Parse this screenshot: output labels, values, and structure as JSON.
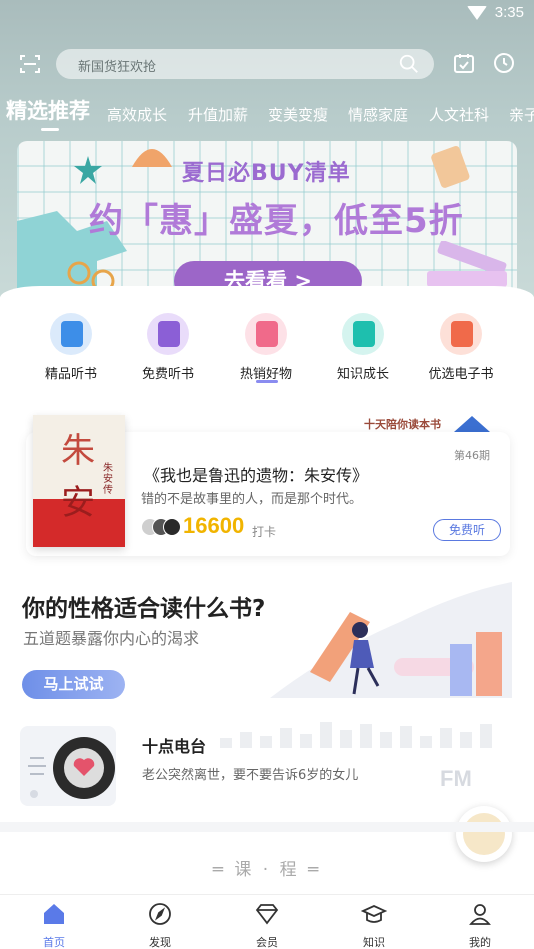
{
  "status": {
    "time": "3:35"
  },
  "search": {
    "placeholder": "新国货狂欢抢"
  },
  "tabs": [
    "精选推荐",
    "高效成长",
    "升值加薪",
    "变美变瘦",
    "情感家庭",
    "人文社科",
    "亲子"
  ],
  "banner": {
    "line1": "夏日必BUY清单",
    "line2": "约「惠」盛夏，低至5折",
    "button": "去看看 >"
  },
  "quick_entries": [
    {
      "label": "精品听书",
      "icon": "audiobook-icon",
      "color": "#3d8ee8"
    },
    {
      "label": "免费听书",
      "icon": "free-book-icon",
      "color": "#8b5fd6"
    },
    {
      "label": "热销好物",
      "icon": "sale-bag-icon",
      "color": "#f06a8a"
    },
    {
      "label": "知识成长",
      "icon": "knowledge-board-icon",
      "color": "#1ebfae"
    },
    {
      "label": "优选电子书",
      "icon": "ebook-icon",
      "color": "#f06a4a"
    }
  ],
  "book": {
    "strip": "十天陪你读本书",
    "issue": "第46期",
    "title": "《我也是鲁迅的遗物：朱安传》",
    "subtitle": "错的不是故事里的人，而是那个时代。",
    "count": "16600",
    "count_suffix": "打卡",
    "listen": "免费听",
    "cover_top": "朱",
    "cover_bottom": "安",
    "cover_side": "朱安传"
  },
  "personality": {
    "title": "你的性格适合读什么书?",
    "subtitle": "五道题暴露你内心的渴求",
    "button": "马上试试"
  },
  "radio": {
    "title": "十点电台",
    "subtitle": "老公突然离世，要不要告诉6岁的女儿",
    "logo": "FM"
  },
  "course": {
    "title": "═ 课 · 程 ═"
  },
  "nav": [
    {
      "label": "首页",
      "icon": "home-icon",
      "active": true
    },
    {
      "label": "发现",
      "icon": "compass-icon",
      "active": false
    },
    {
      "label": "会员",
      "icon": "diamond-icon",
      "active": false
    },
    {
      "label": "知识",
      "icon": "graduation-cap-icon",
      "active": false
    },
    {
      "label": "我的",
      "icon": "profile-icon",
      "active": false
    }
  ],
  "colors": {
    "accent": "#5a7ae8",
    "gold": "#f1b400",
    "banner_purple": "#9c66c8"
  }
}
